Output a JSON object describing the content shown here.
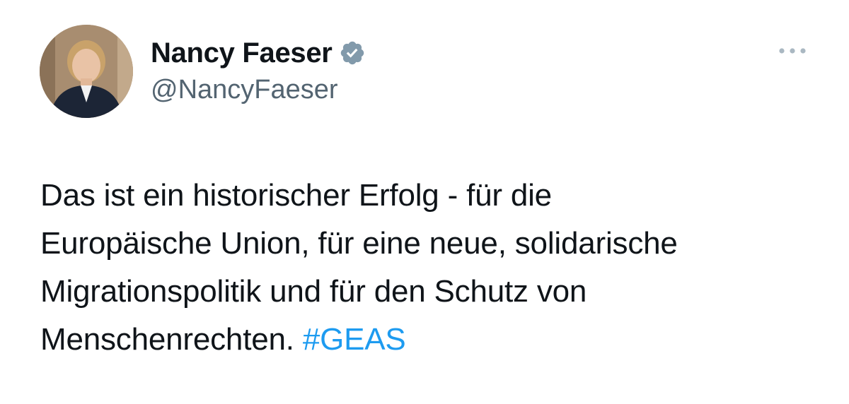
{
  "tweet": {
    "author": {
      "display_name": "Nancy Faeser",
      "handle": "@NancyFaeser",
      "verified": true,
      "avatar_icon": "profile-photo"
    },
    "more_icon": "ellipsis-icon",
    "text_lines": [
      "Das ist ein historischer Erfolg - für die",
      "Europäische Union, für eine neue, solidarische",
      "Migrationspolitik und für den Schutz von",
      "Menschenrechten."
    ],
    "hashtag": "#GEAS"
  },
  "colors": {
    "text": "#0f1419",
    "secondary": "#536471",
    "link": "#1d9bf0",
    "verified_badge": "#829aab"
  }
}
